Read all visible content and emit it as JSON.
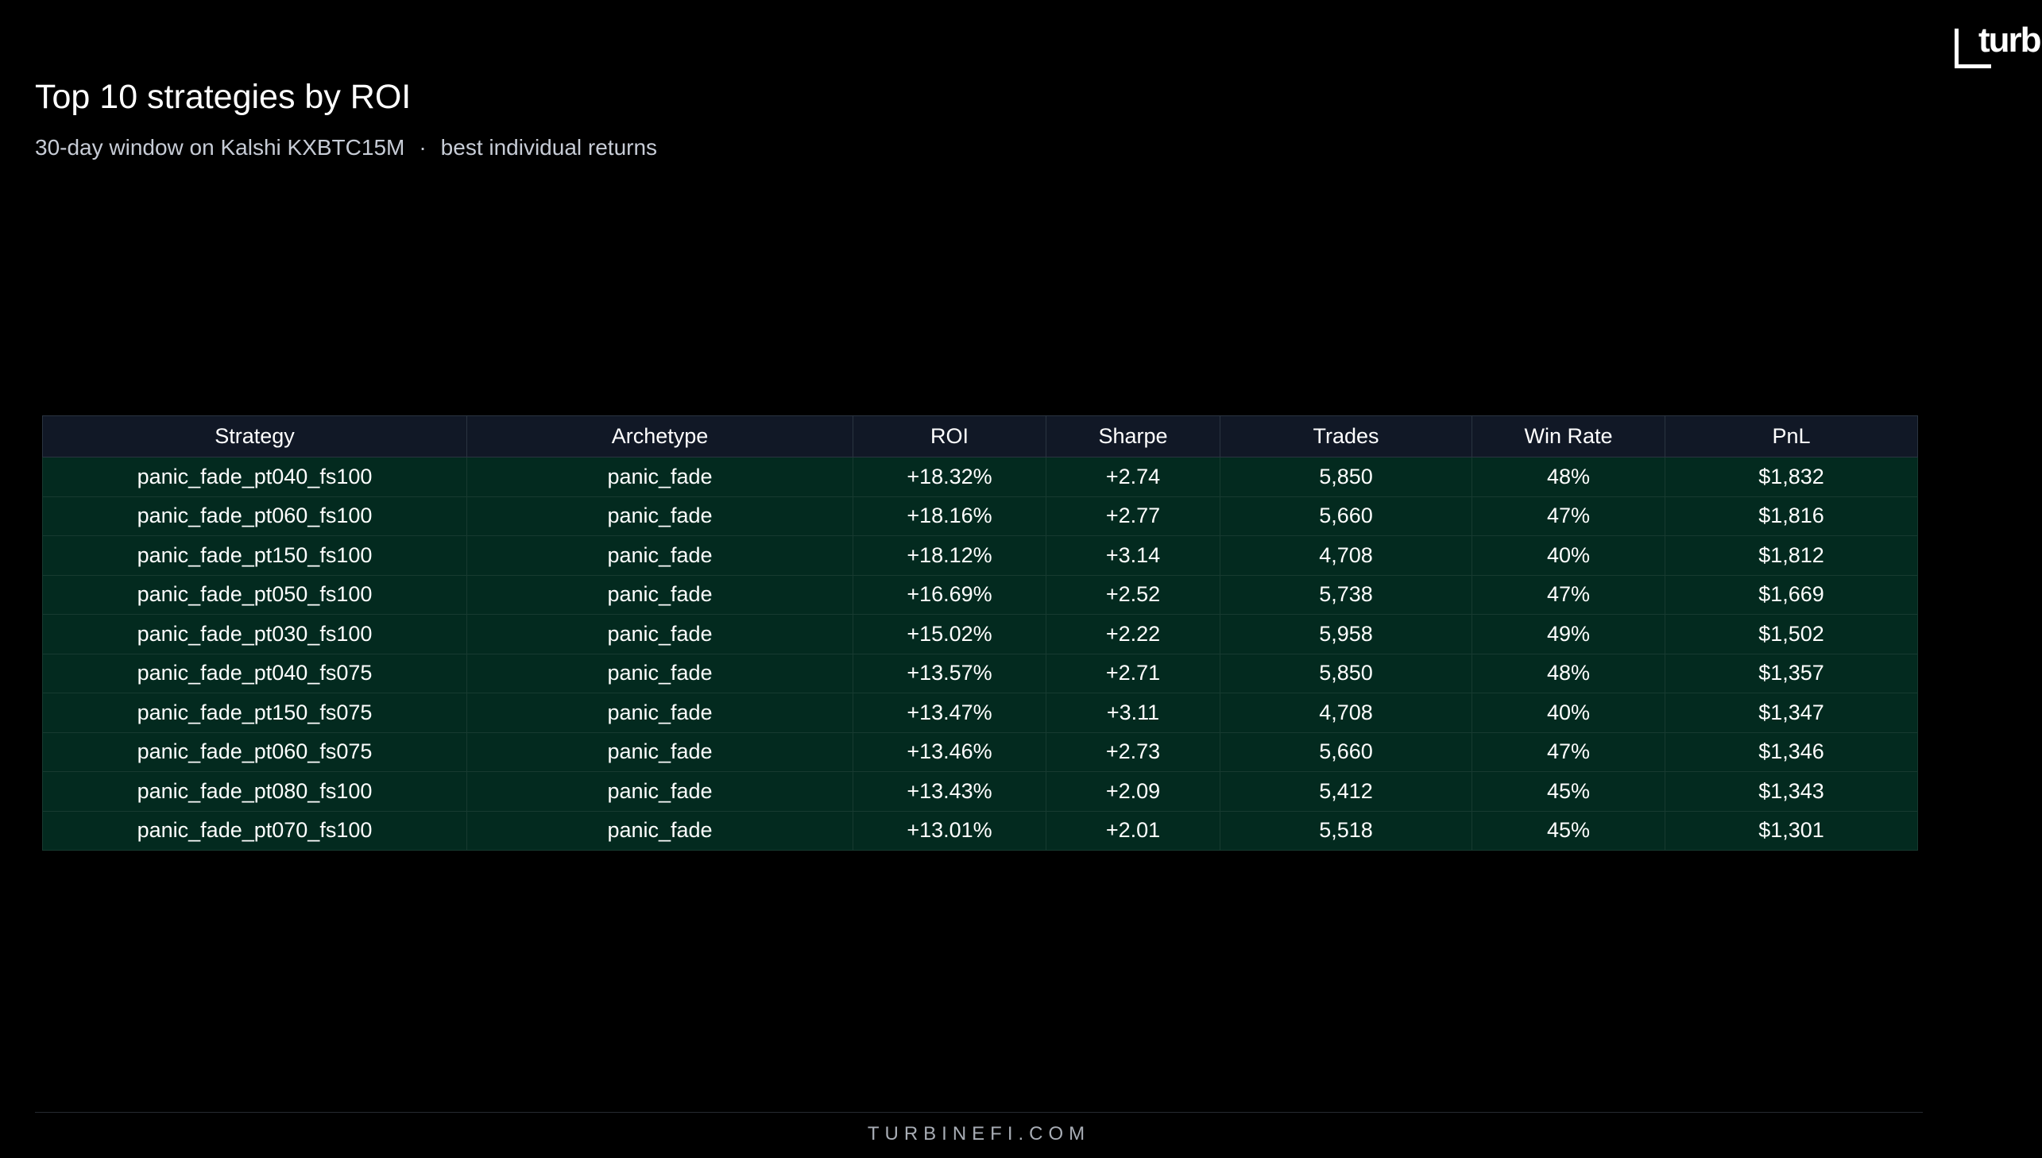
{
  "header": {
    "title": "Top 10 strategies by ROI",
    "subtitle_part1": "30-day window on Kalshi KXBTC15M",
    "subtitle_separator": "·",
    "subtitle_part2": "best individual returns"
  },
  "logo": {
    "text": "turb",
    "icon": "bracket-corner-icon"
  },
  "footer": {
    "text": "TURBINEFI.COM"
  },
  "colors": {
    "background": "#000000",
    "header_row": "#111826",
    "body_row": "#032a1f"
  },
  "chart_data": {
    "type": "table",
    "title": "Top 10 strategies by ROI",
    "columns": [
      "Strategy",
      "Archetype",
      "ROI",
      "Sharpe",
      "Trades",
      "Win Rate",
      "PnL"
    ],
    "rows": [
      [
        "panic_fade_pt040_fs100",
        "panic_fade",
        "+18.32%",
        "+2.74",
        "5,850",
        "48%",
        "$1,832"
      ],
      [
        "panic_fade_pt060_fs100",
        "panic_fade",
        "+18.16%",
        "+2.77",
        "5,660",
        "47%",
        "$1,816"
      ],
      [
        "panic_fade_pt150_fs100",
        "panic_fade",
        "+18.12%",
        "+3.14",
        "4,708",
        "40%",
        "$1,812"
      ],
      [
        "panic_fade_pt050_fs100",
        "panic_fade",
        "+16.69%",
        "+2.52",
        "5,738",
        "47%",
        "$1,669"
      ],
      [
        "panic_fade_pt030_fs100",
        "panic_fade",
        "+15.02%",
        "+2.22",
        "5,958",
        "49%",
        "$1,502"
      ],
      [
        "panic_fade_pt040_fs075",
        "panic_fade",
        "+13.57%",
        "+2.71",
        "5,850",
        "48%",
        "$1,357"
      ],
      [
        "panic_fade_pt150_fs075",
        "panic_fade",
        "+13.47%",
        "+3.11",
        "4,708",
        "40%",
        "$1,347"
      ],
      [
        "panic_fade_pt060_fs075",
        "panic_fade",
        "+13.46%",
        "+2.73",
        "5,660",
        "47%",
        "$1,346"
      ],
      [
        "panic_fade_pt080_fs100",
        "panic_fade",
        "+13.43%",
        "+2.09",
        "5,412",
        "45%",
        "$1,343"
      ],
      [
        "panic_fade_pt070_fs100",
        "panic_fade",
        "+13.01%",
        "+2.01",
        "5,518",
        "45%",
        "$1,301"
      ]
    ]
  }
}
